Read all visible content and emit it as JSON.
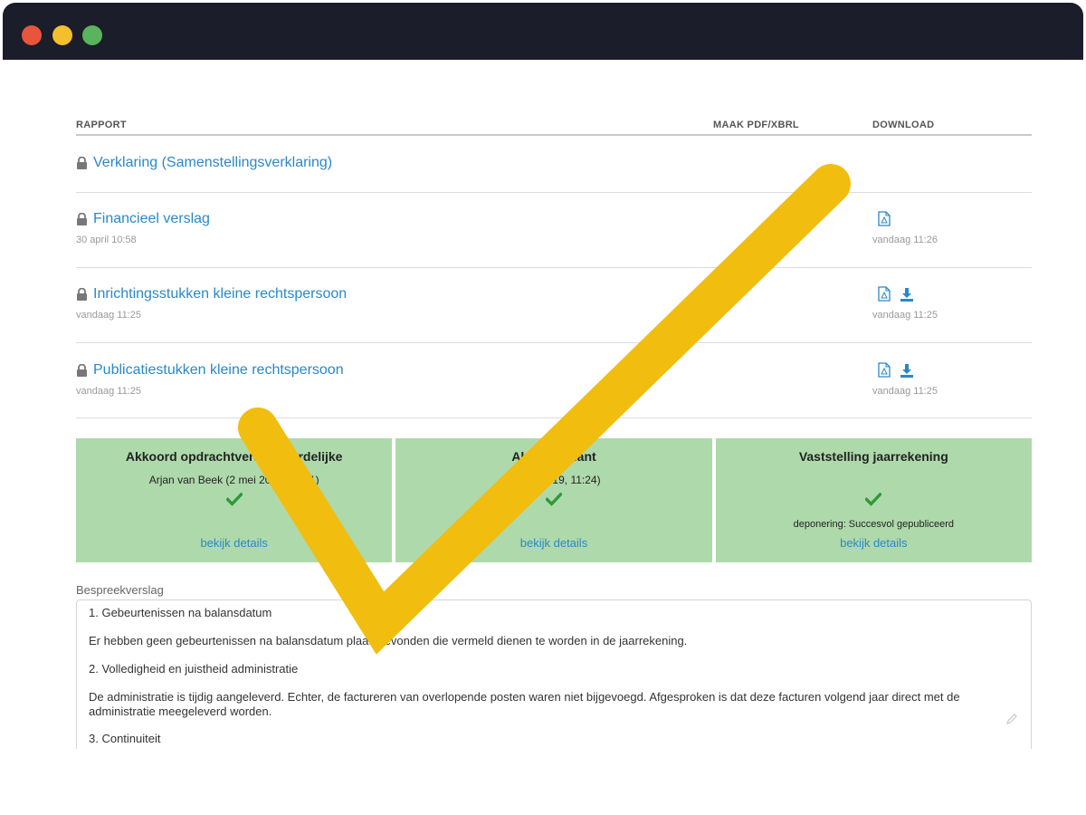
{
  "table": {
    "headers": {
      "rapport": "RAPPORT",
      "maak": "MAAK PDF/XBRL",
      "download": "DOWNLOAD"
    },
    "rows": [
      {
        "title": "Verklaring (Samenstellingsverklaring)",
        "date": "",
        "download_date": ""
      },
      {
        "title": "Financieel verslag",
        "date": "30 april 10:58",
        "download_date": "vandaag 11:26"
      },
      {
        "title": "Inrichtingsstukken kleine rechtspersoon",
        "date": "vandaag 11:25",
        "download_date": "vandaag 11:25"
      },
      {
        "title": "Publicatiestukken kleine rechtspersoon",
        "date": "vandaag 11:25",
        "download_date": "vandaag 11:25"
      }
    ]
  },
  "status": [
    {
      "title": "Akkoord opdrachtverantwoordelijke",
      "sub": "Arjan van Beek (2 mei 2019, 11:21)",
      "note": "",
      "link": "bekijk details"
    },
    {
      "title": "Akkoord klant",
      "sub": "(2 mei 2019, 11:24)",
      "note": "",
      "link": "bekijk details"
    },
    {
      "title": "Vaststelling jaarrekening",
      "sub": "",
      "note": "deponering: Succesvol gepubliceerd",
      "link": "bekijk details"
    }
  ],
  "bespreekverslag": {
    "label": "Bespreekverslag",
    "paragraphs": [
      "1. Gebeurtenissen na balansdatum",
      "Er hebben geen gebeurtenissen na balansdatum plaatsgevonden die vermeld dienen te worden in de jaarrekening.",
      "2. Volledigheid en juistheid administratie",
      "De administratie is tijdig aangeleverd. Echter, de factureren van overlopende posten waren niet bijgevoegd. Afgesproken is dat deze facturen volgend jaar direct met de administratie meegeleverd worden.",
      "3. Continuiteit"
    ]
  },
  "colors": {
    "link": "#2a88c8",
    "status_green": "#aed9ab",
    "check_green": "#2e9a3a",
    "overlay_check": "#f1bd0e"
  }
}
